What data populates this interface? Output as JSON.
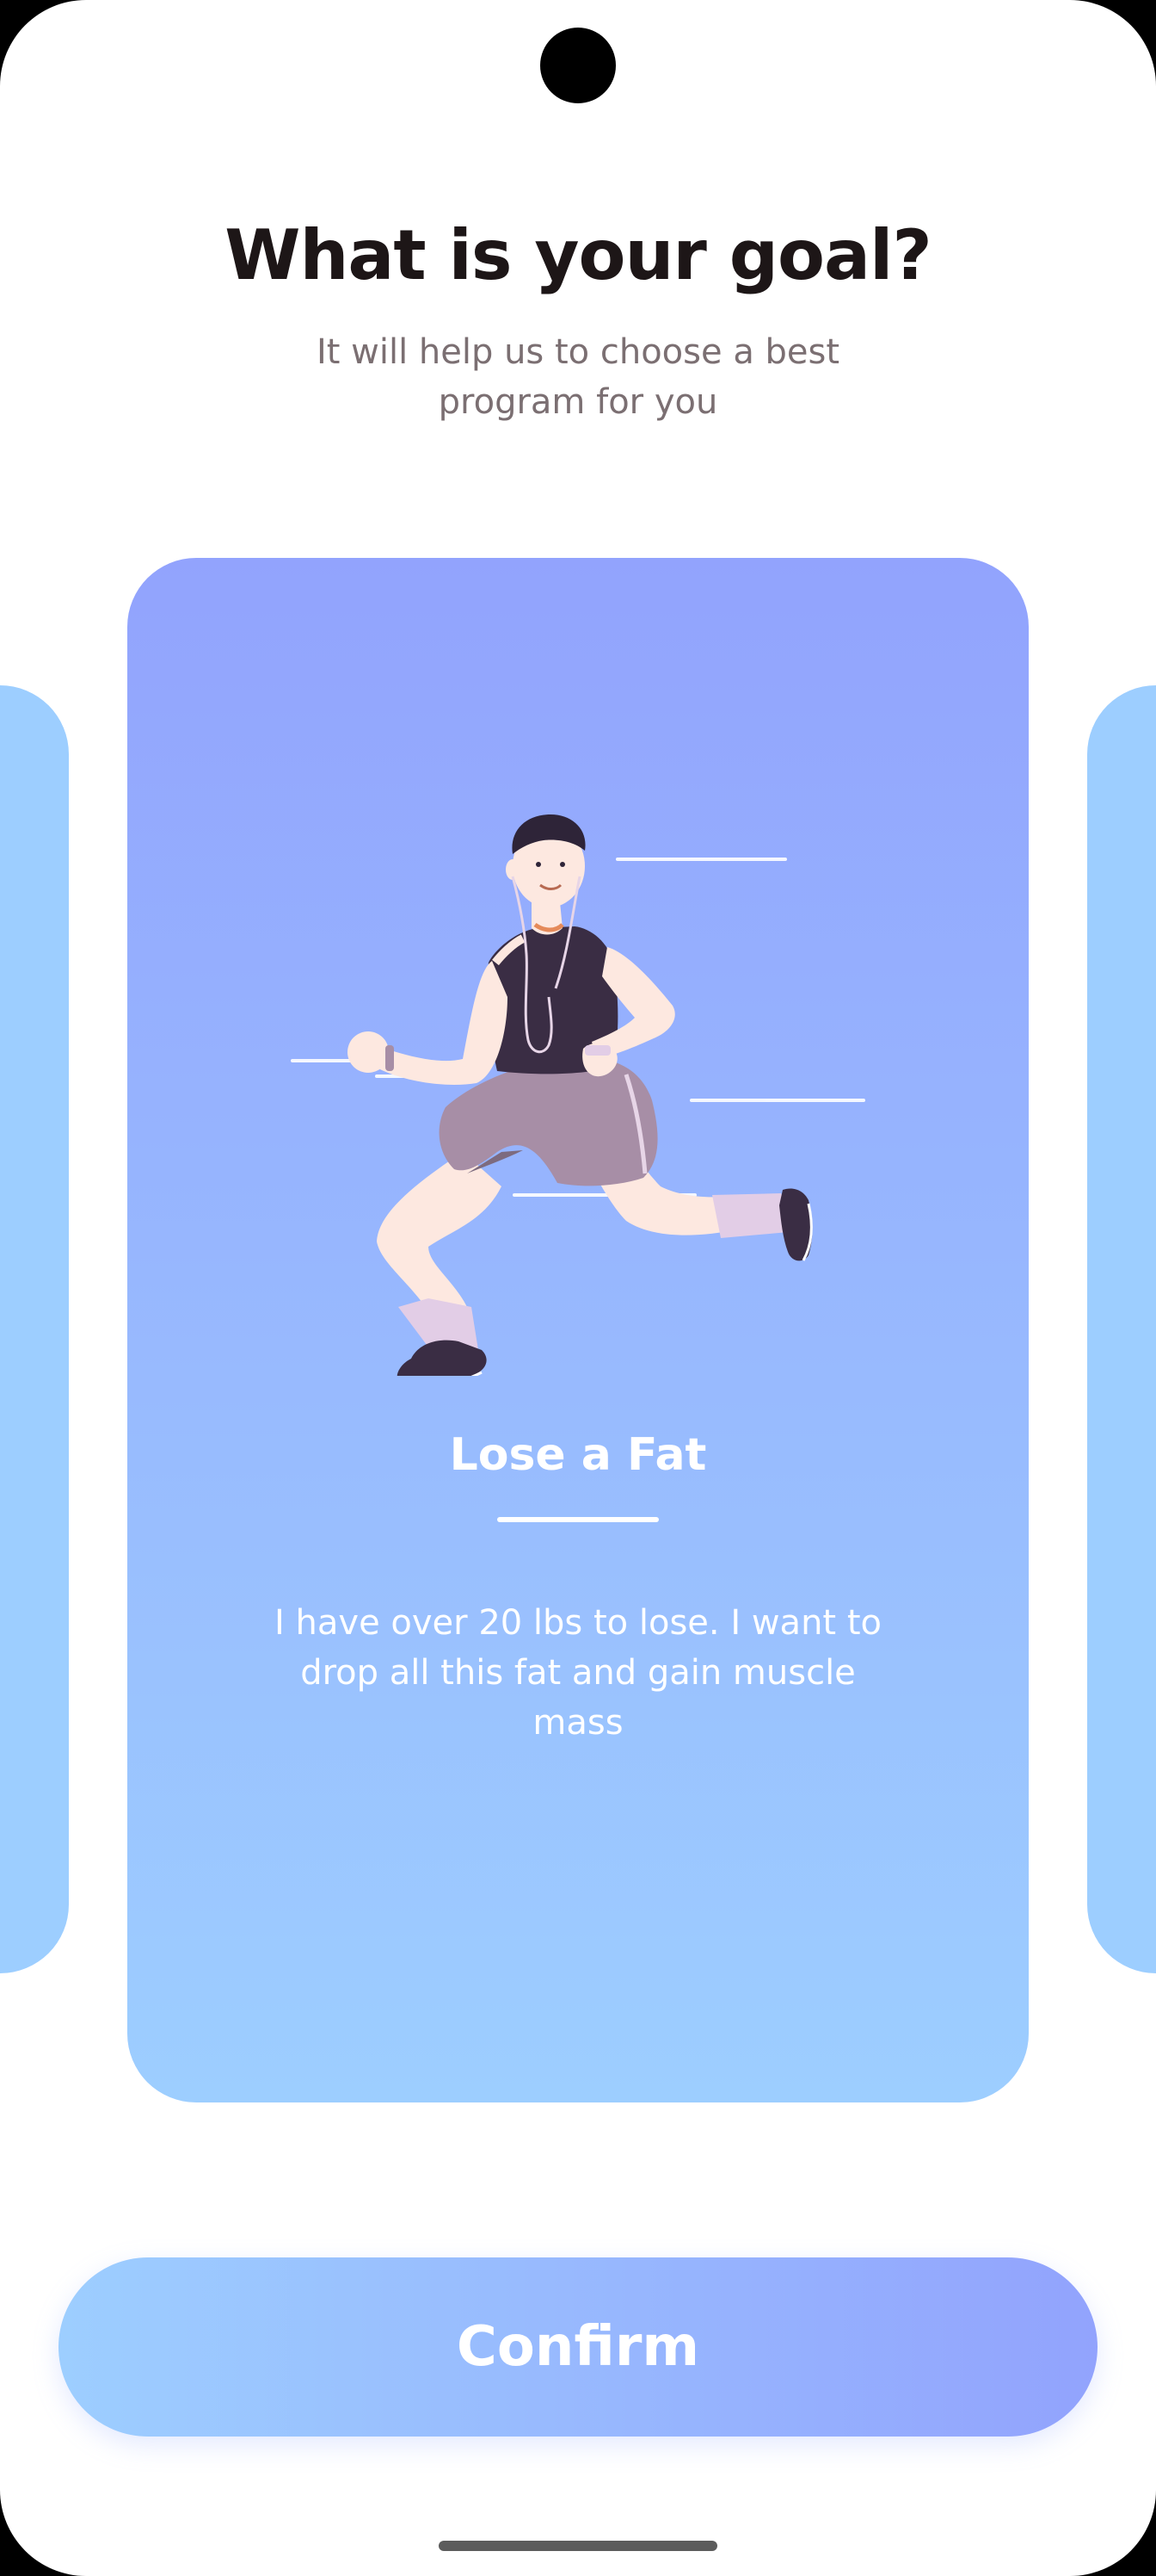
{
  "header": {
    "title": "What is your goal?",
    "subtitle": "It will help us to choose a best program for you"
  },
  "goal_card": {
    "title": "Lose a Fat",
    "description": "I have over 20 lbs to lose. I want to drop all this fat and gain muscle mass",
    "illustration": "running-man-illustration"
  },
  "actions": {
    "confirm_label": "Confirm"
  },
  "colors": {
    "gradient_start": "#92A3FD",
    "gradient_end": "#9DCEFF",
    "title_text": "#1D1617",
    "subtitle_text": "#7B6F72"
  }
}
